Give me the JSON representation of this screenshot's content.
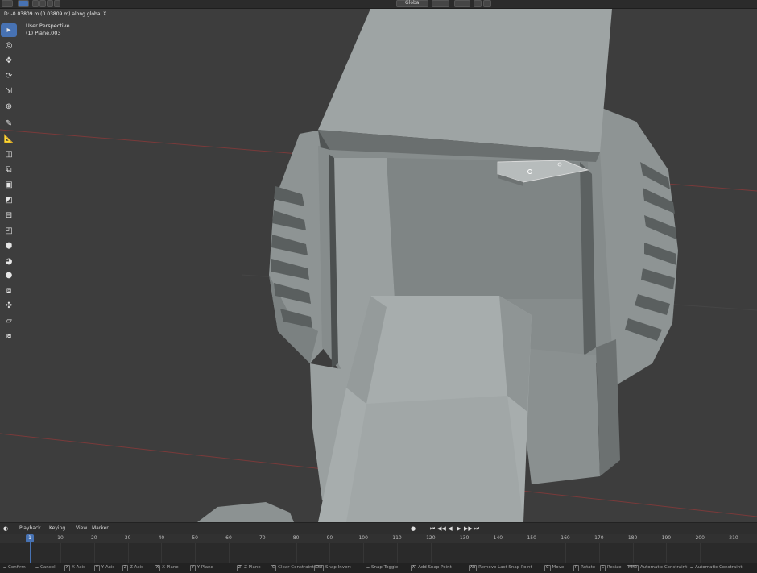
{
  "header": {
    "transform_orientation": "Global",
    "orientation_arrow": "⌄"
  },
  "viewport": {
    "operator_readout": "D: -0.03809 m (0.03809 m) along global X",
    "view_name": "User Perspective",
    "object_name": "(1) Plane.003"
  },
  "toolbar": {
    "tools": [
      {
        "name": "select-box-tool",
        "glyph": "▸"
      },
      {
        "name": "cursor-tool",
        "glyph": "◎"
      },
      {
        "name": "move-tool",
        "glyph": "✥"
      },
      {
        "name": "rotate-tool",
        "glyph": "⟳"
      },
      {
        "name": "scale-tool",
        "glyph": "⇲"
      },
      {
        "name": "transform-tool",
        "glyph": "⊕"
      },
      {
        "name": "annotate-tool",
        "glyph": "✎"
      },
      {
        "name": "measure-tool",
        "glyph": "📐"
      },
      {
        "name": "add-cube-tool",
        "glyph": "◫"
      },
      {
        "name": "extrude-tool",
        "glyph": "⧉"
      },
      {
        "name": "inset-tool",
        "glyph": "▣"
      },
      {
        "name": "bevel-tool",
        "glyph": "◩"
      },
      {
        "name": "loop-cut-tool",
        "glyph": "⊟"
      },
      {
        "name": "knife-tool",
        "glyph": "◰"
      },
      {
        "name": "poly-build-tool",
        "glyph": "⬢"
      },
      {
        "name": "spin-tool",
        "glyph": "◕"
      },
      {
        "name": "smooth-tool",
        "glyph": "●"
      },
      {
        "name": "edge-slide-tool",
        "glyph": "⧈"
      },
      {
        "name": "shrink-fatten-tool",
        "glyph": "✣"
      },
      {
        "name": "shear-tool",
        "glyph": "▱"
      },
      {
        "name": "rip-tool",
        "glyph": "⧇"
      }
    ]
  },
  "timeline": {
    "menus": [
      "Playback",
      "Keying",
      "View",
      "Marker"
    ],
    "current_frame": "1",
    "ticks": [
      "10",
      "20",
      "30",
      "40",
      "50",
      "60",
      "70",
      "80",
      "90",
      "100",
      "110",
      "120",
      "130",
      "140",
      "150",
      "160",
      "170",
      "180",
      "190",
      "200",
      "210"
    ],
    "playback_buttons": [
      "⏮",
      "◀◀",
      "◀",
      "▶",
      "▶▶",
      "⏭"
    ],
    "record_button": "●"
  },
  "statusbar": {
    "items": [
      {
        "key": "",
        "label": "Confirm"
      },
      {
        "key": "",
        "label": "Cancel"
      },
      {
        "key": "X",
        "label": "X Axis"
      },
      {
        "key": "Y",
        "label": "Y Axis"
      },
      {
        "key": "Z",
        "label": "Z Axis"
      },
      {
        "key": "X",
        "label": "X Plane"
      },
      {
        "key": "Y",
        "label": "Y Plane"
      },
      {
        "key": "Z",
        "label": "Z Plane"
      },
      {
        "key": "C",
        "label": "Clear Constraints"
      },
      {
        "key": "Ctrl",
        "label": "Snap Invert"
      },
      {
        "key": "",
        "label": "Snap Toggle"
      },
      {
        "key": "A",
        "label": "Add Snap Point"
      },
      {
        "key": "Alt",
        "label": "Remove Last Snap Point"
      },
      {
        "key": "G",
        "label": "Move"
      },
      {
        "key": "R",
        "label": "Rotate"
      },
      {
        "key": "S",
        "label": "Resize"
      },
      {
        "key": "MMB",
        "label": "Automatic Constraint"
      },
      {
        "key": "",
        "label": "Automatic Constraint"
      }
    ]
  },
  "colors": {
    "accent": "#4772b3",
    "viewport_bg": "#3d3d3d",
    "mesh_light": "#9aa0a0",
    "mesh_dark": "#5a5e5e",
    "x_axis_line": "#8a3a3a"
  }
}
